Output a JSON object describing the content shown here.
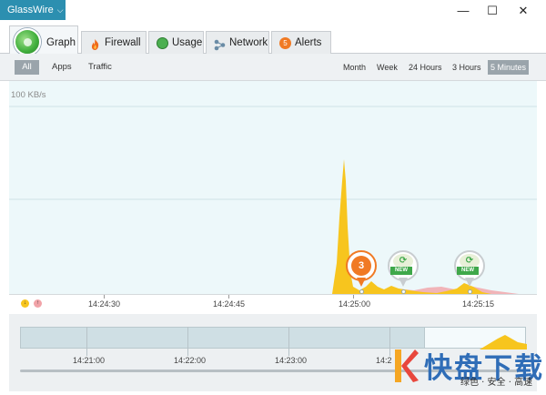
{
  "app": {
    "menu_label": "GlassWire"
  },
  "window": {
    "minimize_glyph": "—",
    "maximize_glyph": "☐",
    "close_glyph": "✕"
  },
  "tabs": [
    {
      "label": "Graph",
      "icon": "graph-logo-icon",
      "active": true
    },
    {
      "label": "Firewall",
      "icon": "flame-icon"
    },
    {
      "label": "Usage",
      "icon": "usage-icon"
    },
    {
      "label": "Network",
      "icon": "network-icon"
    },
    {
      "label": "Alerts",
      "icon": "alerts-icon",
      "count": "5"
    }
  ],
  "filters": {
    "all": "All",
    "apps": "Apps",
    "traffic": "Traffic",
    "selected": "All"
  },
  "time_ranges": {
    "month": "Month",
    "week": "Week",
    "hours24": "24 Hours",
    "hours3": "3 Hours",
    "min5": "5 Minutes",
    "selected": "5 Minutes"
  },
  "graph": {
    "y_label": "100 KB/s",
    "colors": {
      "incoming": "#f7c51e",
      "outgoing": "#f1a3a8",
      "background": "#edf8fa"
    }
  },
  "events": [
    {
      "type": "alert-count",
      "value": "3",
      "color": "#f07a24"
    },
    {
      "type": "new-app",
      "label": "NEW",
      "color": "#3fa84a"
    },
    {
      "type": "new-app",
      "label": "NEW",
      "color": "#3fa84a"
    }
  ],
  "time_axis": {
    "badges": [
      {
        "glyph": "↓",
        "color": "#f7c51e"
      },
      {
        "glyph": "↑",
        "color": "#f1a3a8"
      }
    ],
    "ticks": [
      "14:24:30",
      "14:24:45",
      "14:25:00",
      "14:25:15"
    ]
  },
  "overview": {
    "ticks": [
      "14:21:00",
      "14:22:00",
      "14:23:00",
      "14:2"
    ]
  },
  "watermark": {
    "big": "快盘下载",
    "small": "绿色 · 安全 · 高速"
  }
}
